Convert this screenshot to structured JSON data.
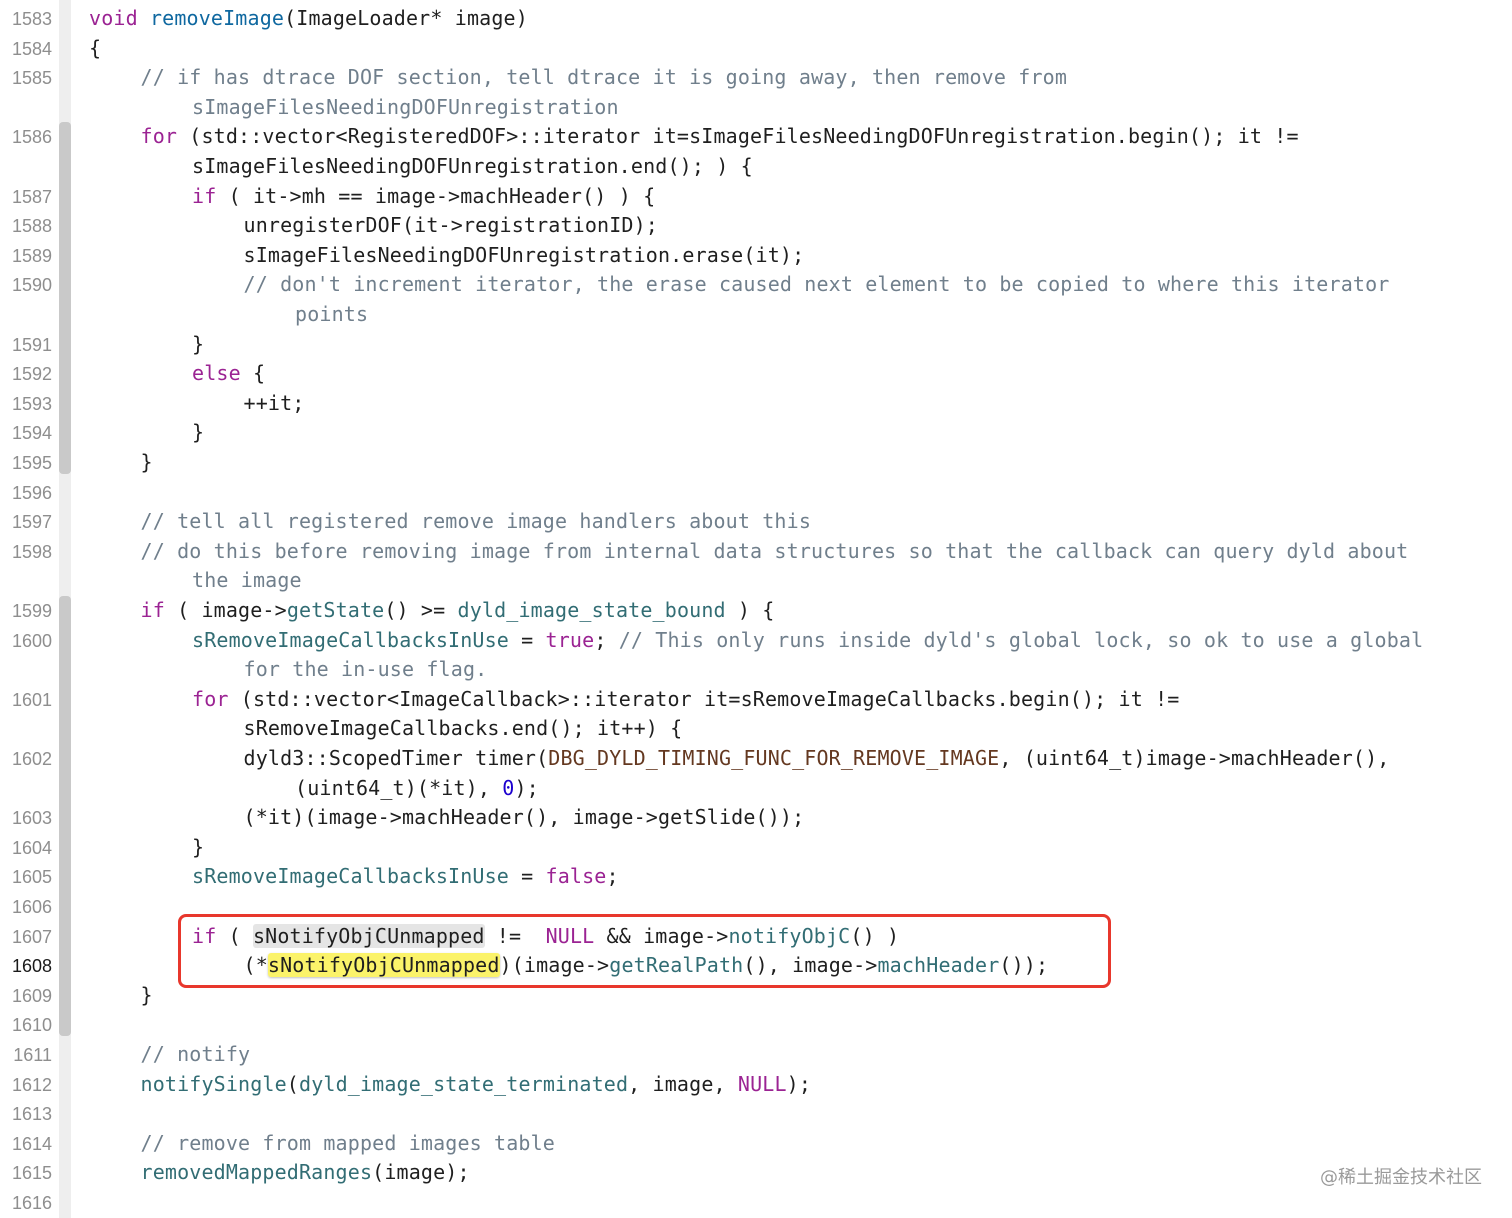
{
  "editor": {
    "lines": [
      {
        "num": "1583",
        "current": false,
        "rows": [
          {
            "indent": 0,
            "tokens": [
              {
                "t": "void",
                "c": "kw"
              },
              {
                "t": " "
              },
              {
                "t": "removeImage",
                "c": "ty"
              },
              {
                "t": "(ImageLoader* image)"
              }
            ]
          }
        ]
      },
      {
        "num": "1584",
        "current": false,
        "rows": [
          {
            "indent": 0,
            "tokens": [
              {
                "t": "{"
              }
            ]
          }
        ]
      },
      {
        "num": "1585",
        "current": false,
        "rows": [
          {
            "indent": 1,
            "tokens": [
              {
                "t": "// if has dtrace DOF section, tell dtrace it is going away, then remove from",
                "c": "cm"
              }
            ]
          },
          {
            "indent": 2,
            "tokens": [
              {
                "t": "sImageFilesNeedingDOFUnregistration",
                "c": "cm"
              }
            ]
          }
        ]
      },
      {
        "num": "1586",
        "current": false,
        "rows": [
          {
            "indent": 1,
            "tokens": [
              {
                "t": "for",
                "c": "kw"
              },
              {
                "t": " (std::vector<RegisteredDOF>::iterator it=sImageFilesNeedingDOFUnregistration.begin(); it !="
              }
            ]
          },
          {
            "indent": 2,
            "tokens": [
              {
                "t": "sImageFilesNeedingDOFUnregistration.end(); ) {"
              }
            ]
          }
        ]
      },
      {
        "num": "1587",
        "current": false,
        "rows": [
          {
            "indent": 2,
            "tokens": [
              {
                "t": "if",
                "c": "kw"
              },
              {
                "t": " ( it->mh == image->machHeader() ) {"
              }
            ]
          }
        ]
      },
      {
        "num": "1588",
        "current": false,
        "rows": [
          {
            "indent": 3,
            "tokens": [
              {
                "t": "unregisterDOF(it->registrationID);"
              }
            ]
          }
        ]
      },
      {
        "num": "1589",
        "current": false,
        "rows": [
          {
            "indent": 3,
            "tokens": [
              {
                "t": "sImageFilesNeedingDOFUnregistration.erase(it);"
              }
            ]
          }
        ]
      },
      {
        "num": "1590",
        "current": false,
        "rows": [
          {
            "indent": 3,
            "tokens": [
              {
                "t": "// don't increment iterator, the erase caused next element to be copied to where this iterator",
                "c": "cm"
              }
            ]
          },
          {
            "indent": 4,
            "tokens": [
              {
                "t": "points",
                "c": "cm"
              }
            ]
          }
        ]
      },
      {
        "num": "1591",
        "current": false,
        "rows": [
          {
            "indent": 2,
            "tokens": [
              {
                "t": "}"
              }
            ]
          }
        ]
      },
      {
        "num": "1592",
        "current": false,
        "rows": [
          {
            "indent": 2,
            "tokens": [
              {
                "t": "else",
                "c": "kw"
              },
              {
                "t": " {"
              }
            ]
          }
        ]
      },
      {
        "num": "1593",
        "current": false,
        "rows": [
          {
            "indent": 3,
            "tokens": [
              {
                "t": "++it;"
              }
            ]
          }
        ]
      },
      {
        "num": "1594",
        "current": false,
        "rows": [
          {
            "indent": 2,
            "tokens": [
              {
                "t": "}"
              }
            ]
          }
        ]
      },
      {
        "num": "1595",
        "current": false,
        "rows": [
          {
            "indent": 1,
            "tokens": [
              {
                "t": "}"
              }
            ]
          }
        ]
      },
      {
        "num": "1596",
        "current": false,
        "rows": [
          {
            "indent": 0,
            "tokens": []
          }
        ]
      },
      {
        "num": "1597",
        "current": false,
        "rows": [
          {
            "indent": 1,
            "tokens": [
              {
                "t": "// tell all registered remove image handlers about this",
                "c": "cm"
              }
            ]
          }
        ]
      },
      {
        "num": "1598",
        "current": false,
        "rows": [
          {
            "indent": 1,
            "tokens": [
              {
                "t": "// do this before removing image from internal data structures so that the callback can query dyld about",
                "c": "cm"
              }
            ]
          },
          {
            "indent": 2,
            "tokens": [
              {
                "t": "the image",
                "c": "cm"
              }
            ]
          }
        ]
      },
      {
        "num": "1599",
        "current": false,
        "rows": [
          {
            "indent": 1,
            "tokens": [
              {
                "t": "if",
                "c": "kw"
              },
              {
                "t": " ( image->"
              },
              {
                "t": "getState",
                "c": "fn"
              },
              {
                "t": "() >= "
              },
              {
                "t": "dyld_image_state_bound",
                "c": "fn"
              },
              {
                "t": " ) {"
              }
            ]
          }
        ]
      },
      {
        "num": "1600",
        "current": false,
        "rows": [
          {
            "indent": 2,
            "tokens": [
              {
                "t": "sRemoveImageCallbacksInUse",
                "c": "fn"
              },
              {
                "t": " = "
              },
              {
                "t": "true",
                "c": "kw"
              },
              {
                "t": "; "
              },
              {
                "t": "// This only runs inside dyld's global lock, so ok to use a global",
                "c": "cm"
              }
            ]
          },
          {
            "indent": 3,
            "tokens": [
              {
                "t": "for the in-use flag.",
                "c": "cm"
              }
            ]
          }
        ]
      },
      {
        "num": "1601",
        "current": false,
        "rows": [
          {
            "indent": 2,
            "tokens": [
              {
                "t": "for",
                "c": "kw"
              },
              {
                "t": " (std::vector<ImageCallback>::iterator it=sRemoveImageCallbacks.begin(); it !="
              }
            ]
          },
          {
            "indent": 3,
            "tokens": [
              {
                "t": "sRemoveImageCallbacks.end(); it++) {"
              }
            ]
          }
        ]
      },
      {
        "num": "1602",
        "current": false,
        "rows": [
          {
            "indent": 3,
            "tokens": [
              {
                "t": "dyld3::ScopedTimer timer("
              },
              {
                "t": "DBG_DYLD_TIMING_FUNC_FOR_REMOVE_IMAGE",
                "c": "mac"
              },
              {
                "t": ", (uint64_t)image->machHeader(),"
              }
            ]
          },
          {
            "indent": 4,
            "tokens": [
              {
                "t": "(uint64_t)(*it), "
              },
              {
                "t": "0",
                "c": "num"
              },
              {
                "t": ");"
              }
            ]
          }
        ]
      },
      {
        "num": "1603",
        "current": false,
        "rows": [
          {
            "indent": 3,
            "tokens": [
              {
                "t": "(*it)(image->machHeader(), image->getSlide());"
              }
            ]
          }
        ]
      },
      {
        "num": "1604",
        "current": false,
        "rows": [
          {
            "indent": 2,
            "tokens": [
              {
                "t": "}"
              }
            ]
          }
        ]
      },
      {
        "num": "1605",
        "current": false,
        "rows": [
          {
            "indent": 2,
            "tokens": [
              {
                "t": "sRemoveImageCallbacksInUse",
                "c": "fn"
              },
              {
                "t": " = "
              },
              {
                "t": "false",
                "c": "kw"
              },
              {
                "t": ";"
              }
            ]
          }
        ]
      },
      {
        "num": "1606",
        "current": false,
        "rows": [
          {
            "indent": 0,
            "tokens": []
          }
        ]
      },
      {
        "num": "1607",
        "current": false,
        "rows": [
          {
            "indent": 2,
            "tokens": [
              {
                "t": "if",
                "c": "kw"
              },
              {
                "t": " ( "
              },
              {
                "t": "sNotifyObjCUnmapped",
                "h": "gray"
              },
              {
                "t": " !=  "
              },
              {
                "t": "NULL",
                "c": "kw"
              },
              {
                "t": " && image->"
              },
              {
                "t": "notifyObjC",
                "c": "fn"
              },
              {
                "t": "() )"
              }
            ]
          }
        ]
      },
      {
        "num": "1608",
        "current": true,
        "rows": [
          {
            "indent": 3,
            "tokens": [
              {
                "t": "(*"
              },
              {
                "t": "sNotifyObjCUnmapped",
                "h": "yellow"
              },
              {
                "t": ")(image->"
              },
              {
                "t": "getRealPath",
                "c": "fn"
              },
              {
                "t": "(), image->"
              },
              {
                "t": "machHeader",
                "c": "fn"
              },
              {
                "t": "());"
              }
            ]
          }
        ]
      },
      {
        "num": "1609",
        "current": false,
        "rows": [
          {
            "indent": 1,
            "tokens": [
              {
                "t": "}"
              }
            ]
          }
        ]
      },
      {
        "num": "1610",
        "current": false,
        "rows": [
          {
            "indent": 0,
            "tokens": []
          }
        ]
      },
      {
        "num": "1611",
        "current": false,
        "rows": [
          {
            "indent": 1,
            "tokens": [
              {
                "t": "// notify",
                "c": "cm"
              }
            ]
          }
        ]
      },
      {
        "num": "1612",
        "current": false,
        "rows": [
          {
            "indent": 1,
            "tokens": [
              {
                "t": "notifySingle",
                "c": "fn"
              },
              {
                "t": "("
              },
              {
                "t": "dyld_image_state_terminated",
                "c": "fn"
              },
              {
                "t": ", image, "
              },
              {
                "t": "NULL",
                "c": "kw"
              },
              {
                "t": ");"
              }
            ]
          }
        ]
      },
      {
        "num": "1613",
        "current": false,
        "rows": [
          {
            "indent": 0,
            "tokens": []
          }
        ]
      },
      {
        "num": "1614",
        "current": false,
        "rows": [
          {
            "indent": 1,
            "tokens": [
              {
                "t": "// remove from mapped images table",
                "c": "cm"
              }
            ]
          }
        ]
      },
      {
        "num": "1615",
        "current": false,
        "rows": [
          {
            "indent": 1,
            "tokens": [
              {
                "t": "removedMappedRanges",
                "c": "fn"
              },
              {
                "t": "(image);"
              }
            ]
          }
        ]
      },
      {
        "num": "1616",
        "current": false,
        "rows": [
          {
            "indent": 0,
            "tokens": []
          }
        ]
      }
    ]
  },
  "watermark": "@稀土掘金技术社区",
  "colors": {
    "keyword": "#9b2393",
    "function": "#326d74",
    "type": "#0f68a0",
    "comment": "#707f8c",
    "macro": "#643820",
    "number": "#1c00cf",
    "annotation_box": "#e8372c",
    "match_highlight": "#fbf36a"
  }
}
